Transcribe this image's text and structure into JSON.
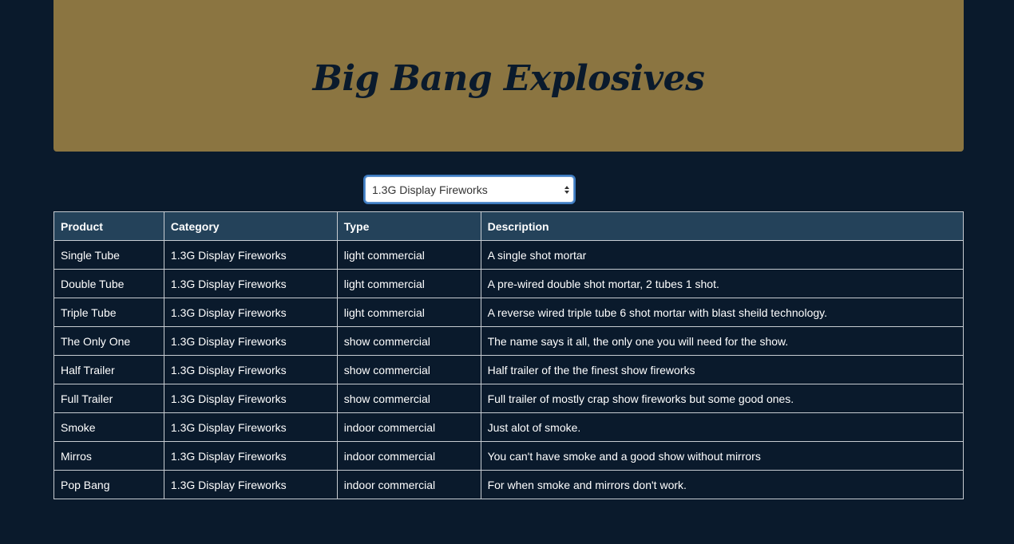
{
  "header": {
    "title": "Big Bang Explosives"
  },
  "filter": {
    "selected": "1.3G Display Fireworks"
  },
  "table": {
    "columns": [
      "Product",
      "Category",
      "Type",
      "Description"
    ],
    "rows": [
      [
        "Single Tube",
        "1.3G Display Fireworks",
        "light commercial",
        "A single shot mortar"
      ],
      [
        "Double Tube",
        "1.3G Display Fireworks",
        "light commercial",
        "A pre-wired double shot mortar, 2 tubes 1 shot."
      ],
      [
        "Triple Tube",
        "1.3G Display Fireworks",
        "light commercial",
        "A reverse wired triple tube 6 shot mortar with blast sheild technology."
      ],
      [
        "The Only One",
        "1.3G Display Fireworks",
        "show commercial",
        "The name says it all, the only one you will need for the show."
      ],
      [
        "Half Trailer",
        "1.3G Display Fireworks",
        "show commercial",
        "Half trailer of the the finest show fireworks"
      ],
      [
        "Full Trailer",
        "1.3G Display Fireworks",
        "show commercial",
        "Full trailer of mostly crap show fireworks but some good ones."
      ],
      [
        "Smoke",
        "1.3G Display Fireworks",
        "indoor commercial",
        "Just alot of smoke."
      ],
      [
        "Mirros",
        "1.3G Display Fireworks",
        "indoor commercial",
        "You can't have smoke and a good show without mirrors"
      ],
      [
        "Pop Bang",
        "1.3G Display Fireworks",
        "indoor commercial",
        "For when smoke and mirrors don't work."
      ]
    ]
  }
}
